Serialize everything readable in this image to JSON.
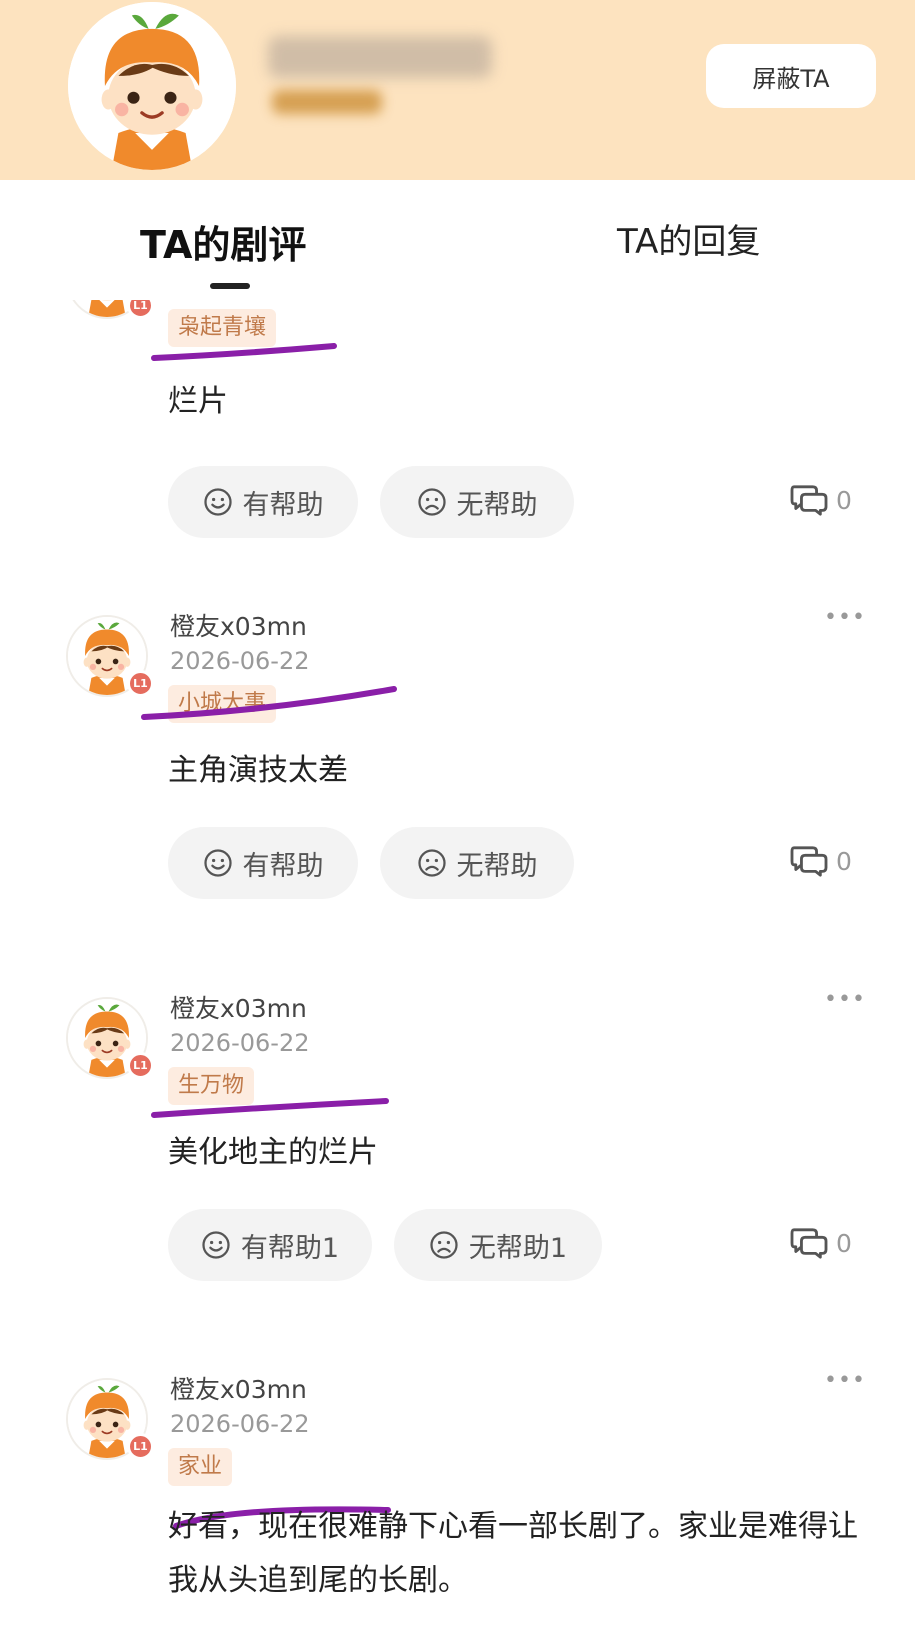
{
  "header": {
    "block_label": "屏蔽TA",
    "colors": {
      "background": "#fde3bf",
      "button_bg": "#ffffff"
    }
  },
  "tabs": {
    "reviews_label": "TA的剧评",
    "replies_label": "TA的回复",
    "active": "TA的剧评"
  },
  "reviews": [
    {
      "show": "枭起青壤",
      "text": "烂片",
      "helpful_label": "有帮助",
      "unhelpful_label": "无帮助",
      "comment_count": "0"
    },
    {
      "username": "橙友x03mn",
      "date": "2026-06-22",
      "level": "L1",
      "show": "小城大事",
      "text": "主角演技太差",
      "helpful_label": "有帮助",
      "unhelpful_label": "无帮助",
      "comment_count": "0"
    },
    {
      "username": "橙友x03mn",
      "date": "2026-06-22",
      "level": "L1",
      "show": "生万物",
      "text": "美化地主的烂片",
      "helpful_label": "有帮助1",
      "unhelpful_label": "无帮助1",
      "comment_count": "0"
    },
    {
      "username": "橙友x03mn",
      "date": "2026-06-22",
      "level": "L1",
      "show": "家业",
      "text": "好看，现在很难静下心看一部长剧了。家业是难得让我从头追到尾的长剧。"
    }
  ],
  "icons": {
    "helpful": "smile-icon",
    "unhelpful": "frown-icon",
    "comments": "comment-bubbles-icon",
    "more": "more-dots-icon"
  },
  "colors": {
    "pill_bg": "#f3f3f3",
    "show_tag_bg": "#fdece0",
    "show_tag_text": "#c07a4a",
    "level_badge": "#e56c5e",
    "annotation_underline": "#8a1fa8"
  }
}
